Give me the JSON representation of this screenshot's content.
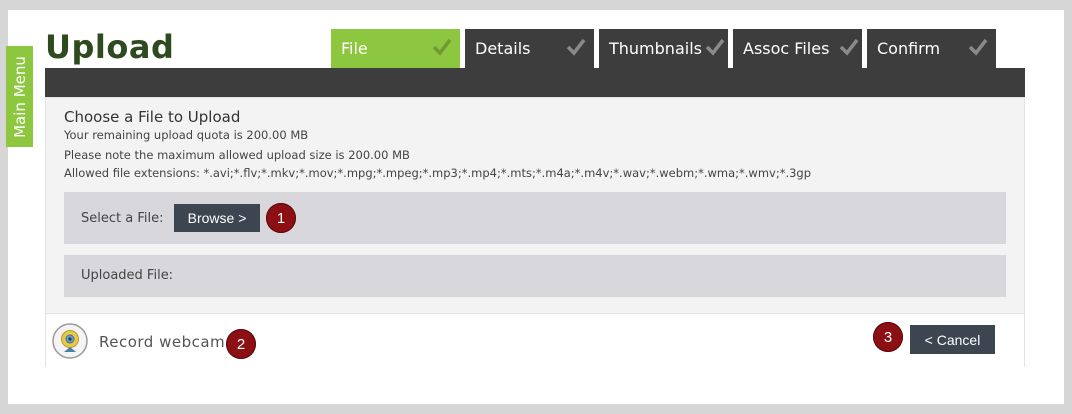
{
  "main_menu": {
    "label": "Main Menu"
  },
  "page": {
    "title": "Upload"
  },
  "tabs": [
    {
      "label": "File",
      "active": true,
      "icon": "check-icon"
    },
    {
      "label": "Details",
      "active": false,
      "icon": "check-icon"
    },
    {
      "label": "Thumbnails",
      "active": false,
      "icon": "check-icon"
    },
    {
      "label": "Assoc Files",
      "active": false,
      "icon": "check-icon"
    },
    {
      "label": "Confirm",
      "active": false,
      "icon": "check-icon"
    }
  ],
  "upload": {
    "heading": "Choose a File to Upload",
    "quota": "Your remaining upload quota is 200.00 MB",
    "max_size": "Please note the maximum allowed upload size is 200.00 MB",
    "extensions": "Allowed file extensions: *.avi;*.flv;*.mkv;*.mov;*.mpg;*.mpeg;*.mp3;*.mp4;*.mts;*.m4a;*.m4v;*.wav;*.webm;*.wma;*.wmv;*.3gp",
    "select_label": "Select a File:",
    "browse_label": "Browse >",
    "uploaded_label": "Uploaded File:"
  },
  "footer": {
    "webcam_label": "Record webcam",
    "webcam_icon": "webcam-icon",
    "cancel_label": "< Cancel"
  },
  "badges": {
    "one": "1",
    "two": "2",
    "three": "3"
  },
  "colors": {
    "accent_green": "#8dc63f",
    "dark_gray": "#3d3d3d",
    "badge_red": "#8b0f13",
    "button_slate": "#3d4550",
    "title_green": "#2e4a1f"
  }
}
